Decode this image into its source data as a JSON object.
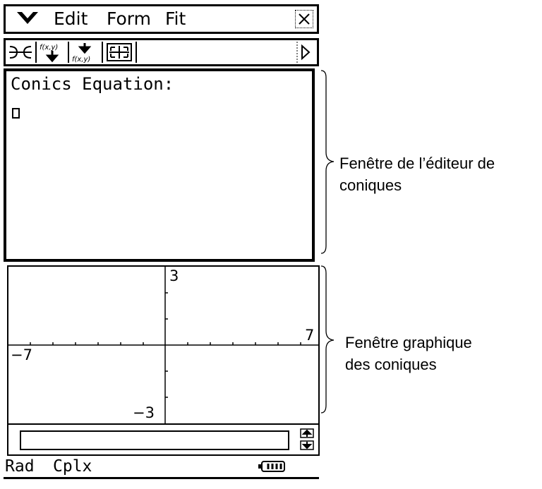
{
  "menubar": {
    "items": [
      "Edit",
      "Form",
      "Fit"
    ]
  },
  "toolbar": {
    "buttons": [
      "intersection-icon",
      "store-function-icon",
      "recall-function-icon",
      "zoom-fit-icon"
    ],
    "function_label": "f(x,y)"
  },
  "editor": {
    "title": "Conics Equation:"
  },
  "graph": {
    "y_max_label": "3",
    "y_min_label": "−3",
    "x_max_label": "7",
    "x_min_label": "−7"
  },
  "statusbar": {
    "angle_mode": "Rad",
    "complex_mode": "Cplx"
  },
  "callouts": {
    "editor_line1": "Fenêtre de l’éditeur de",
    "editor_line2": "coniques",
    "graph_line1": "Fenêtre graphique",
    "graph_line2": "des coniques"
  }
}
